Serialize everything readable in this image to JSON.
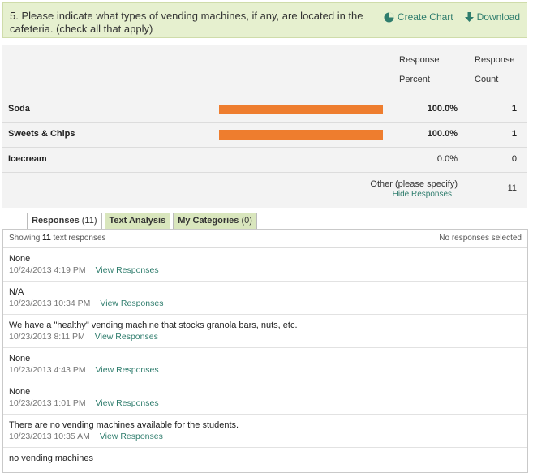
{
  "question": {
    "title": "5. Please indicate what types of vending machines, if any, are located in the cafeteria. (check all that apply)",
    "create_chart_label": "Create Chart",
    "download_label": "Download"
  },
  "summary": {
    "header_percent_line1": "Response",
    "header_percent_line2": "Percent",
    "header_count_line1": "Response",
    "header_count_line2": "Count",
    "rows": [
      {
        "label": "Soda",
        "percent": "100.0%",
        "count": "1",
        "fraction": 1.0
      },
      {
        "label": "Sweets & Chips",
        "percent": "100.0%",
        "count": "1",
        "fraction": 1.0
      },
      {
        "label": "Icecream",
        "percent": "0.0%",
        "count": "0",
        "fraction": 0.0
      }
    ],
    "other_label": "Other (please specify)",
    "hide_label": "Hide Responses",
    "other_count": "11",
    "bar_color": "#ee7d2e"
  },
  "tabs": [
    {
      "label": "Responses",
      "count": "(11)"
    },
    {
      "label": "Text Analysis",
      "count": ""
    },
    {
      "label": "My Categories",
      "count": "(0)"
    }
  ],
  "panel": {
    "showing_prefix": "Showing",
    "showing_count": "11",
    "showing_suffix": "text responses",
    "selection_status": "No responses selected",
    "view_label": "View Responses",
    "responses": [
      {
        "text": "None",
        "date": "10/24/2013 4:19 PM"
      },
      {
        "text": "N/A",
        "date": "10/23/2013 10:34 PM"
      },
      {
        "text": "We have a \"healthy\" vending machine that stocks granola bars, nuts, etc.",
        "date": "10/23/2013 8:11 PM"
      },
      {
        "text": "None",
        "date": "10/23/2013 4:43 PM"
      },
      {
        "text": "None",
        "date": "10/23/2013 1:01 PM"
      },
      {
        "text": "There are no vending machines available for the students.",
        "date": "10/23/2013 10:35 AM"
      },
      {
        "text": "no vending machines",
        "date": ""
      }
    ]
  },
  "colors": {
    "accent": "#2f7d6d",
    "header_bg": "#e6f0cf",
    "tab_bg": "#d9e6bd"
  }
}
